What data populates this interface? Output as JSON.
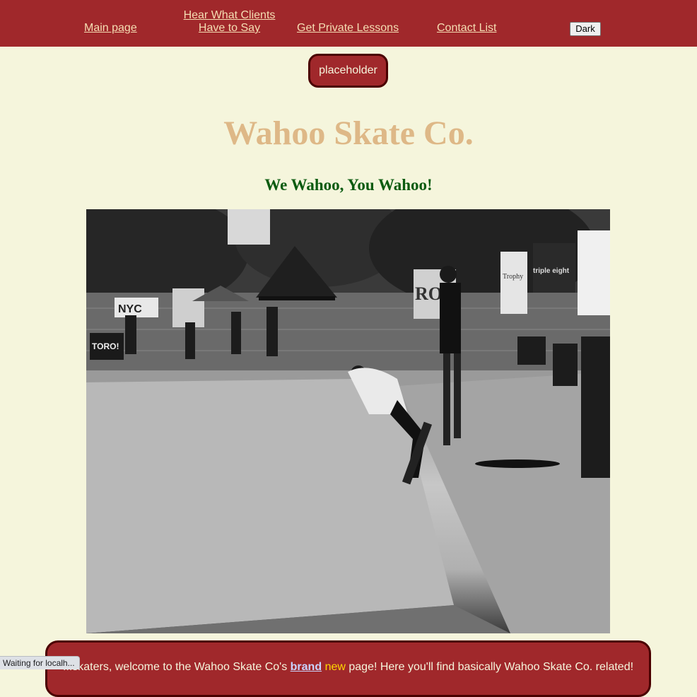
{
  "nav": {
    "main_page": "Main page",
    "clients_line1": "Hear What Clients",
    "clients_line2": "Have to Say",
    "lessons": "Get Private Lessons",
    "contact": "Contact List",
    "dark_button": "Dark"
  },
  "placeholder_button": "placeholder",
  "title": "Wahoo Skate Co.",
  "subtitle": "We Wahoo, You Wahoo!",
  "welcome": {
    "before": "...skaters, welcome to the Wahoo Skate Co's ",
    "brand": "brand",
    "new": "new",
    "after": " page! Here you'll find basically Wahoo Skate Co. related!"
  },
  "banners": {
    "nyc": "NYC",
    "toro": "TORO!",
    "rock": "ROC",
    "trophy": "Trophy",
    "triple_eight": "triple eight"
  },
  "status_bar": "Waiting for localh..."
}
